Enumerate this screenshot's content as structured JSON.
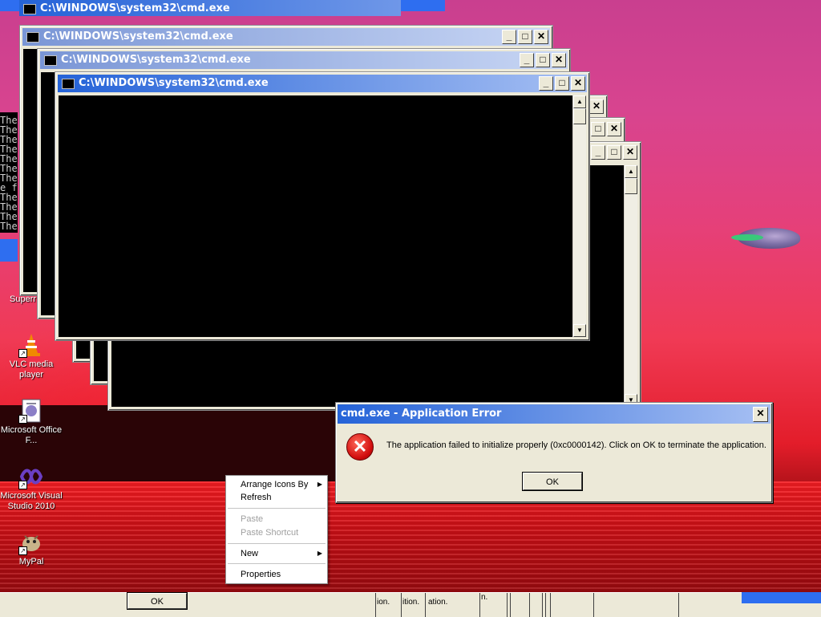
{
  "windows": {
    "cmd_title": "C:\\WINDOWS\\system32\\cmd.exe",
    "console_lines": [
      "The",
      "The",
      "The",
      "The",
      "The",
      "The",
      "The",
      "e f",
      "The",
      "The",
      "The",
      "The"
    ]
  },
  "desktop_icons": [
    {
      "label": "Superr",
      "icon": "partial-icon"
    },
    {
      "label": "VLC media player",
      "icon": "vlc-cone-icon"
    },
    {
      "label": "Microsoft Office F...",
      "icon": "office-document-icon"
    },
    {
      "label": "Microsoft Visual Studio 2010",
      "icon": "visual-studio-icon"
    },
    {
      "label": "MyPal",
      "icon": "mypal-icon"
    }
  ],
  "dialog": {
    "title": "cmd.exe - Application Error",
    "message": "The application failed to initialize properly (0xc0000142). Click on OK to terminate the application.",
    "ok_label": "OK",
    "close_glyph": "✕",
    "icon": "error-x-icon"
  },
  "context_menu": {
    "arrange": "Arrange Icons By",
    "refresh": "Refresh",
    "paste": "Paste",
    "paste_shortcut": "Paste Shortcut",
    "new": "New",
    "properties": "Properties"
  },
  "taskbar": {
    "ok_label": "OK",
    "fragments": [
      "ion.",
      "ition.",
      "ation.",
      "n."
    ]
  },
  "colors": {
    "titlebar_active": "#2563d8",
    "dialog_bg": "#ece9d8",
    "error_red": "#d10d0d"
  }
}
